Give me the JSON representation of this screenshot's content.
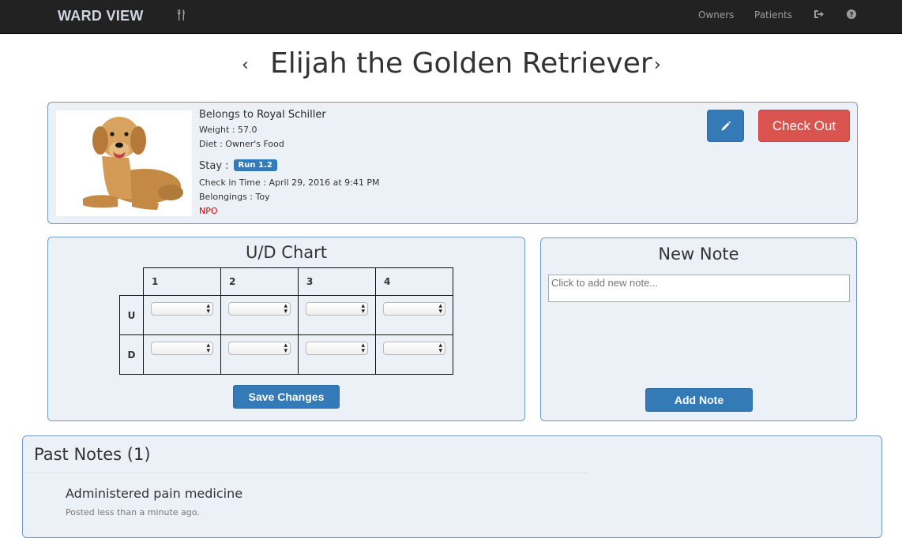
{
  "nav": {
    "brand": "WARD VIEW",
    "links": [
      "Owners",
      "Patients"
    ]
  },
  "page": {
    "title": "Elijah the Golden Retriever",
    "prev_arrow": "‹",
    "next_arrow": "›"
  },
  "patient": {
    "owner_prefix": "Belongs to ",
    "owner_name": "Royal Schiller",
    "weight": "Weight : 57.0",
    "diet": "Diet : Owner's Food",
    "stay_label": "Stay :",
    "run_badge": "Run 1.2",
    "checkin": "Check in Time : April 29, 2016 at 9:41 PM",
    "belongings": "Belongings : Toy",
    "status": "NPO",
    "checkout_label": "Check Out"
  },
  "ud_chart": {
    "title": "U/D Chart",
    "columns": [
      "1",
      "2",
      "3",
      "4"
    ],
    "rows": [
      "U",
      "D"
    ],
    "save_label": "Save Changes"
  },
  "new_note": {
    "title": "New Note",
    "placeholder": "Click to add new note...",
    "add_label": "Add Note"
  },
  "past_notes": {
    "title": "Past Notes (1)",
    "items": [
      {
        "text": "Administered pain medicine",
        "time": "Posted less than a minute ago."
      }
    ]
  },
  "colors": {
    "primary": "#337ab7",
    "danger": "#d9534f",
    "panel_bg": "#ecf1f8",
    "panel_border": "#6f9bcb",
    "navbar": "#222222"
  }
}
